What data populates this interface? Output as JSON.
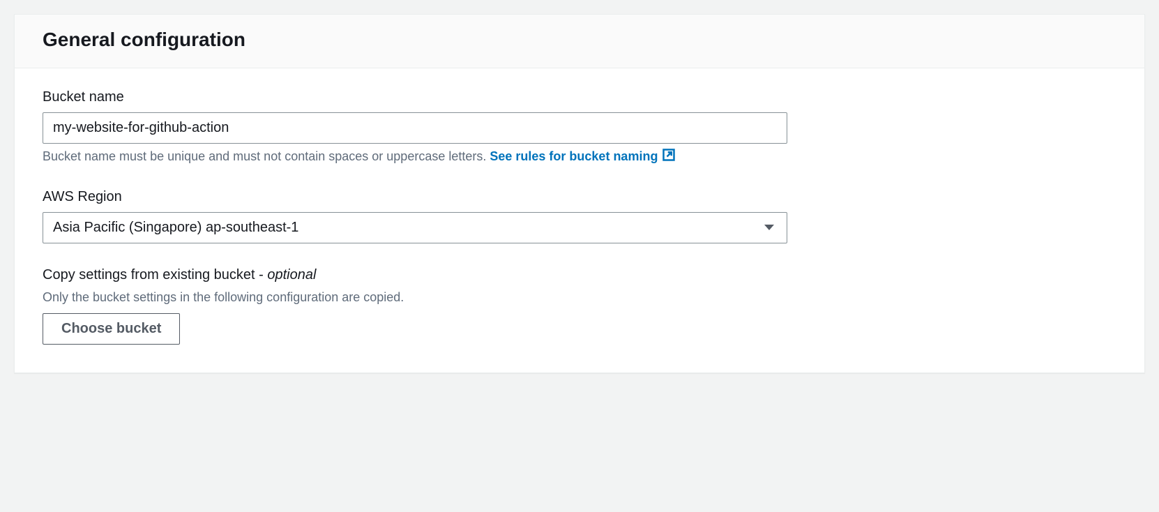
{
  "panel": {
    "title": "General configuration"
  },
  "bucketName": {
    "label": "Bucket name",
    "value": "my-website-for-github-action",
    "hintPrefix": "Bucket name must be unique and must not contain spaces or uppercase letters. ",
    "rulesLinkText": "See rules for bucket naming"
  },
  "region": {
    "label": "AWS Region",
    "value": "Asia Pacific (Singapore) ap-southeast-1"
  },
  "copySettings": {
    "labelMain": "Copy settings from existing bucket - ",
    "labelOptional": "optional",
    "hint": "Only the bucket settings in the following configuration are copied.",
    "buttonLabel": "Choose bucket"
  }
}
